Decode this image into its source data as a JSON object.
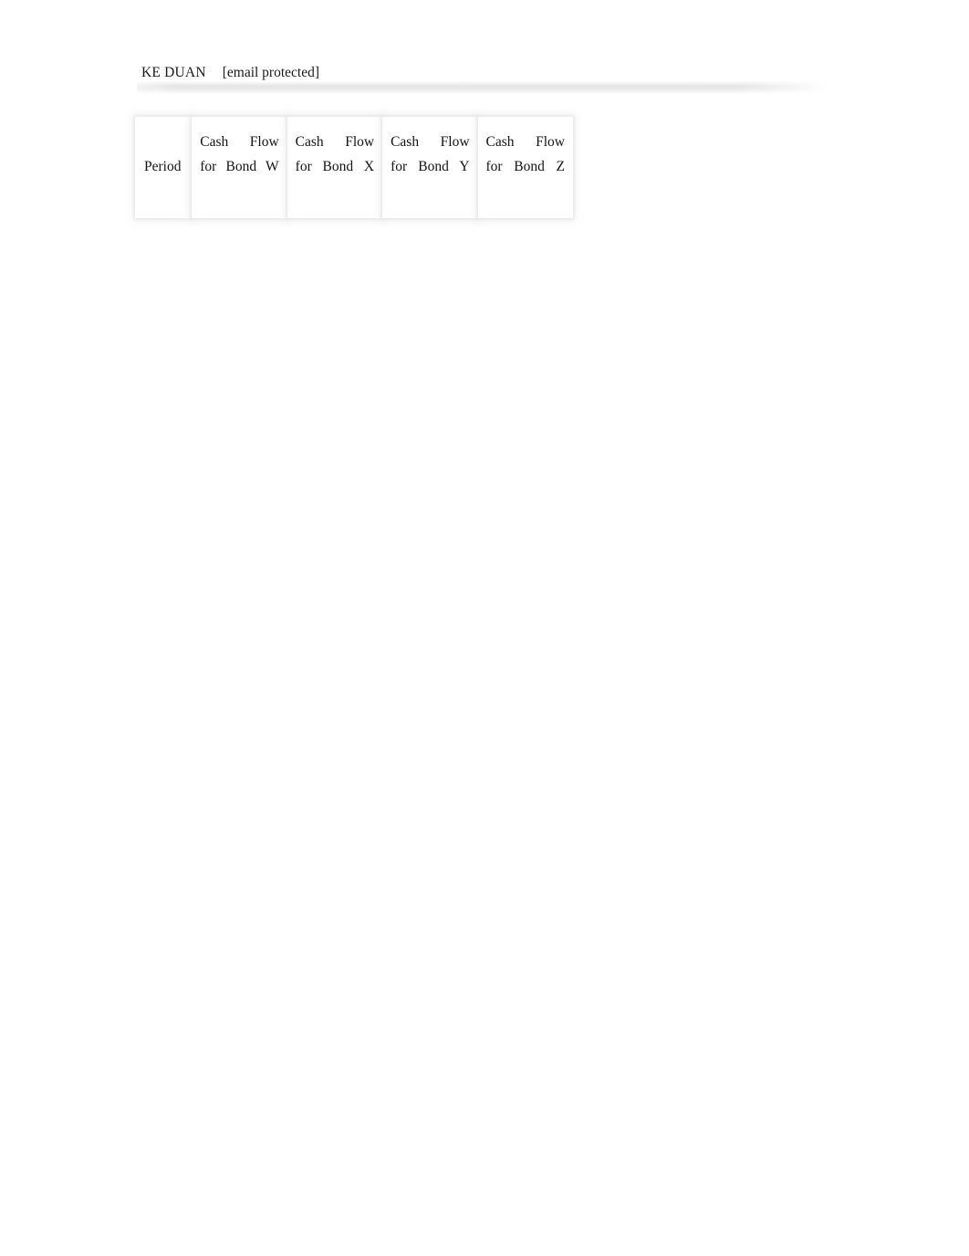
{
  "page": {
    "background_color": "#ffffff",
    "text_color": "#141414"
  },
  "header": {
    "author": "KE DUAN",
    "email": "[email protected]",
    "rule_color": "#e8e8e8"
  },
  "table": {
    "name": "bond-cash-flow-table",
    "columns": [
      {
        "key": "period",
        "label": "Period"
      },
      {
        "key": "bond_w",
        "label": "Cash Flow for Bond W"
      },
      {
        "key": "bond_x",
        "label": "Cash Flow for Bond X"
      },
      {
        "key": "bond_y",
        "label": "Cash Flow for Bond Y"
      },
      {
        "key": "bond_z",
        "label": "Cash Flow for Bond Z"
      }
    ],
    "rows": []
  }
}
